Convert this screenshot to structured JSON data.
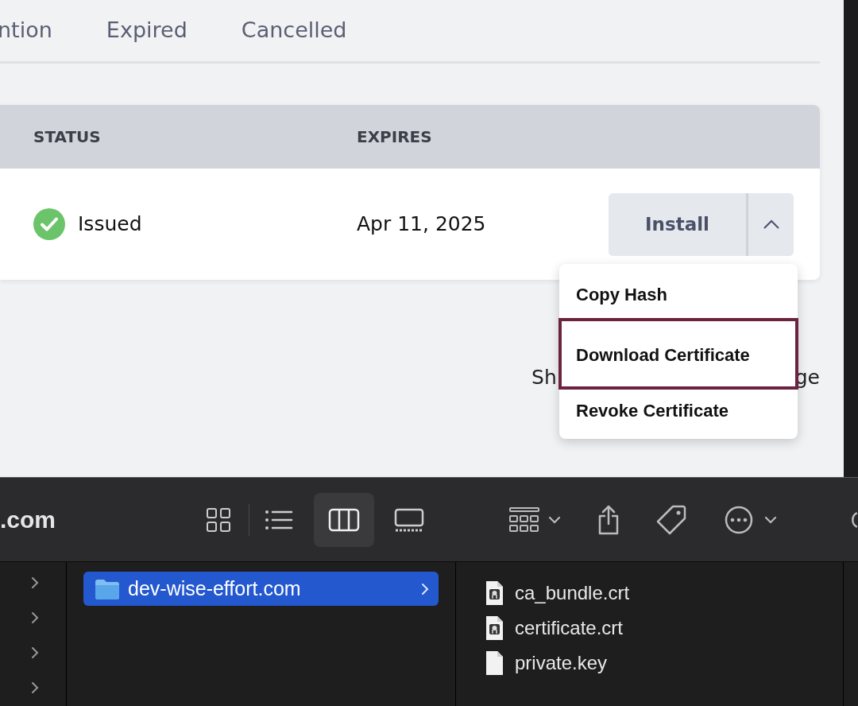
{
  "tabs": [
    {
      "label": "ntion",
      "selected": false
    },
    {
      "label": "Expired",
      "selected": false
    },
    {
      "label": "Cancelled",
      "selected": false
    }
  ],
  "table": {
    "columns": [
      "STATUS",
      "EXPIRES"
    ],
    "rows": [
      {
        "status": "Issued",
        "expires": "Apr 11, 2025",
        "action": "Install",
        "menu_expanded": true
      }
    ]
  },
  "menu": {
    "items": [
      {
        "label": "Copy Hash",
        "selected": false
      },
      {
        "label": "Download Certificate",
        "selected": true
      },
      {
        "label": "Revoke Certificate",
        "selected": false
      }
    ]
  },
  "footer_fragments": [
    "Sh",
    "ge"
  ],
  "finder": {
    "title": ".com",
    "view_modes": [
      {
        "kind": "icons",
        "selected": false
      },
      {
        "kind": "list",
        "selected": false
      },
      {
        "kind": "columns",
        "selected": true
      },
      {
        "kind": "gallery",
        "selected": false
      }
    ],
    "folders": [
      {
        "name": "dev-wise-effort.com",
        "selected": true
      }
    ],
    "files": [
      {
        "name": "ca_bundle.crt",
        "kind": "certificate"
      },
      {
        "name": "certificate.crt",
        "kind": "certificate"
      },
      {
        "name": "private.key",
        "kind": "document"
      }
    ]
  }
}
